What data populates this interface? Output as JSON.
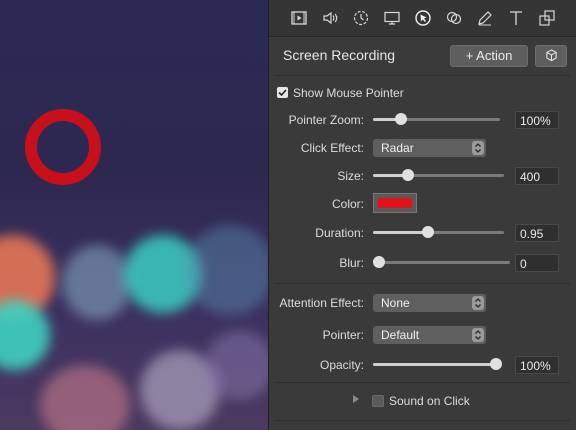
{
  "toolbar": {
    "icons": [
      "film-icon",
      "speaker-icon",
      "timer-icon",
      "screen-icon",
      "pointer-icon",
      "overlay-icon",
      "pen-icon",
      "text-icon",
      "transform-icon"
    ]
  },
  "panel": {
    "title": "Screen Recording",
    "action_button": "+ Action",
    "show_mouse_pointer": {
      "label": "Show Mouse Pointer",
      "checked": true
    },
    "pointer_zoom": {
      "label": "Pointer Zoom:",
      "value": "100%",
      "slider": 0.22
    },
    "click_effect": {
      "label": "Click Effect:",
      "selected": "Radar"
    },
    "size": {
      "label": "Size:",
      "value": "400",
      "slider": 0.27
    },
    "color": {
      "label": "Color:",
      "swatch": "#e0121a"
    },
    "duration": {
      "label": "Duration:",
      "value": "0.95",
      "slider": 0.42
    },
    "blur": {
      "label": "Blur:",
      "value": "0",
      "slider": 0.0
    },
    "attention_effect": {
      "label": "Attention Effect:",
      "selected": "None"
    },
    "pointer": {
      "label": "Pointer:",
      "selected": "Default"
    },
    "opacity": {
      "label": "Opacity:",
      "value": "100%",
      "slider": 1.0
    },
    "sound_on_click": {
      "label": "Sound on Click",
      "checked": false
    }
  },
  "colors": {
    "accent_click_ring": "#c8101a",
    "panel_bg": "#3a3a3a"
  }
}
